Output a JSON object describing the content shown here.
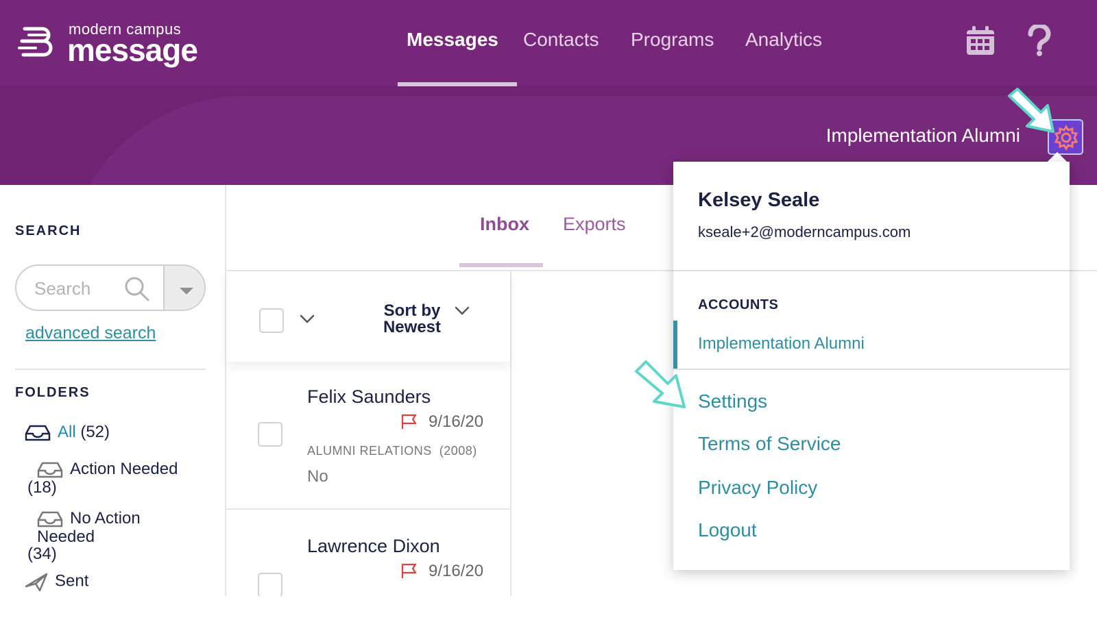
{
  "brand": {
    "top": "modern campus",
    "main": "message"
  },
  "nav": {
    "messages": "Messages",
    "contacts": "Contacts",
    "programs": "Programs",
    "analytics": "Analytics"
  },
  "header": {
    "account_name": "Implementation Alumni"
  },
  "sidebar": {
    "search_label": "SEARCH",
    "search_placeholder": "Search",
    "advanced_search": "advanced search",
    "folders_label": "FOLDERS",
    "folders": [
      {
        "name": "All",
        "count": "(52)"
      },
      {
        "name": "Action Needed",
        "count": "(18)"
      },
      {
        "name_line1": "No Action",
        "name_line2": "Needed",
        "count": "(34)"
      },
      {
        "name": "Sent"
      }
    ]
  },
  "tabs": {
    "inbox": "Inbox",
    "exports": "Exports"
  },
  "list": {
    "sort_line1": "Sort by",
    "sort_line2": "Newest",
    "messages": [
      {
        "name": "Felix Saunders",
        "date": "9/16/20",
        "group": "ALUMNI RELATIONS",
        "group_count": "(2008)",
        "preview": "No"
      },
      {
        "name": "Lawrence Dixon",
        "date": "9/16/20"
      }
    ]
  },
  "menu": {
    "user_name": "Kelsey Seale",
    "email": "kseale+2@moderncampus.com",
    "accounts_label": "ACCOUNTS",
    "account": "Implementation Alumni",
    "settings": "Settings",
    "terms": "Terms of Service",
    "privacy": "Privacy Policy",
    "logout": "Logout"
  },
  "colors": {
    "purple": "#77277a",
    "teal": "#2e8e9e",
    "navy": "#1c2245",
    "arrow": "#5fd6c8",
    "flag": "#e0403a"
  }
}
